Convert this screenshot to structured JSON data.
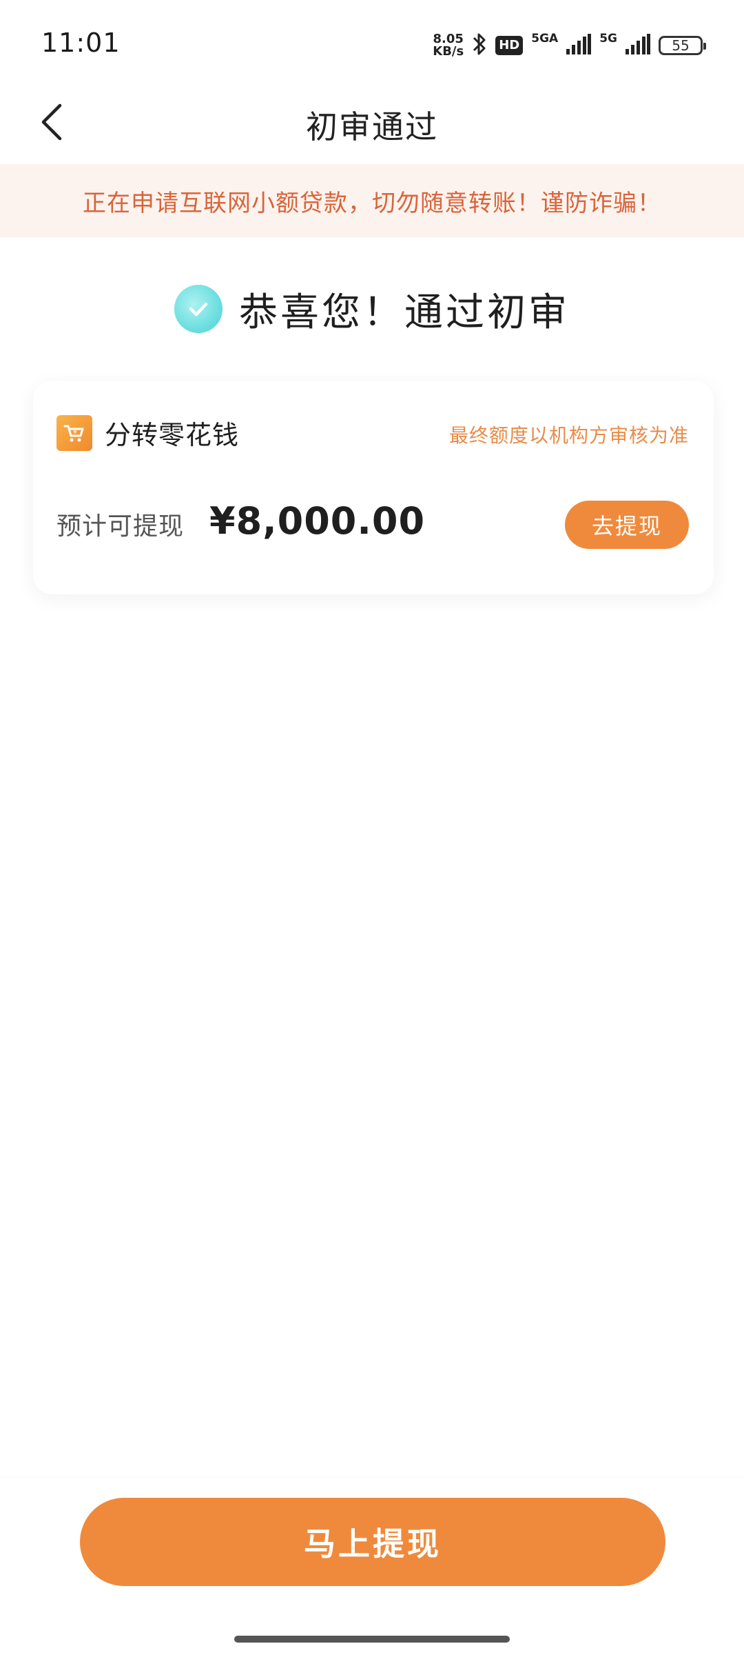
{
  "status_bar": {
    "time": "11:01",
    "net_speed_value": "8.05",
    "net_speed_unit": "KB/s",
    "hd_label": "HD",
    "signal1_label": "5GA",
    "signal2_label": "5G",
    "battery": "55"
  },
  "nav": {
    "title": "初审通过"
  },
  "warning": {
    "text": "正在申请互联网小额贷款，切勿随意转账！谨防诈骗！"
  },
  "success": {
    "text": "恭喜您！通过初审"
  },
  "card": {
    "product_name": "分转零花钱",
    "limit_note": "最终额度以机构方审核为准",
    "estimate_label": "预计可提现",
    "estimate_amount": "¥8,000.00",
    "withdraw_label": "去提现"
  },
  "bottom": {
    "main_button_label": "马上提现"
  },
  "colors": {
    "accent": "#ef8a3c",
    "warning_bg": "#fcf3ee",
    "warning_text": "#d9643a",
    "check": "#6ddfe0"
  },
  "icons": {
    "back": "chevron-left-icon",
    "check": "check-icon",
    "logo": "shopping-cart-icon",
    "bluetooth": "bluetooth-icon"
  }
}
